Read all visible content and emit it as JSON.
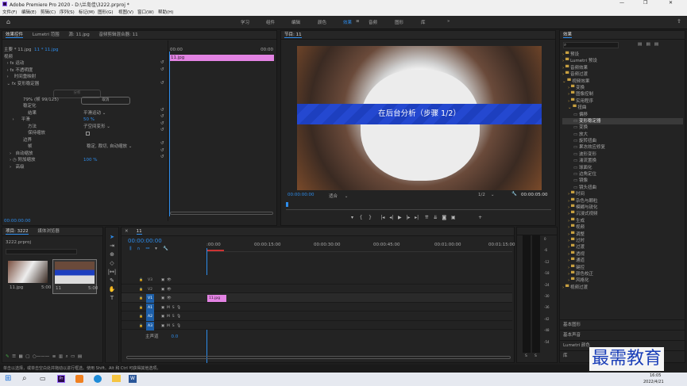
{
  "window": {
    "title": "Adobe Premiere Pro 2020 - D:\\兰岛佳\\3222.prproj *",
    "controls": [
      "—",
      "❐",
      "✕"
    ]
  },
  "menu": [
    "文件(F)",
    "编辑(E)",
    "剪辑(C)",
    "序列(S)",
    "标记(M)",
    "图形(G)",
    "视图(V)",
    "窗口(W)",
    "帮助(H)"
  ],
  "workspaces": [
    "学习",
    "组件",
    "编辑",
    "颜色",
    "效果",
    "音频",
    "图形",
    "库"
  ],
  "workspace_active": "效果",
  "effect_controls": {
    "tabs": [
      "效果控件",
      "Lumetri 范围",
      "源: 11.jpg",
      "音频剪辑混合器: 11"
    ],
    "master": "主要 * 11.jpg",
    "seq": "11 * 11.jpg",
    "tc_start": "00:00",
    "tc_end": "00:00",
    "clip": "11.jpg",
    "section": "视频",
    "rows": [
      "运动",
      "不透明度",
      "时间重映射",
      "变形稳定器"
    ],
    "status_line": "79% (帧 99/125)",
    "analyze_label": "分析",
    "cancel_label": "取消",
    "stab": "稳定化",
    "result_label": "结果",
    "result_val": "平滑运动",
    "smooth_label": "平滑",
    "smooth_val": "50 %",
    "method_label": "方法",
    "method_val": "子空间变形",
    "keep_scale": "保持缩放",
    "borders": "边界",
    "framing_label": "帧",
    "framing_val": "稳定, 裁切, 自动缩放",
    "auto_scale": "自动缩放",
    "extra_scale": "附加缩放",
    "extra_val": "100 %",
    "advanced": "高级",
    "timecode": "00:00:00:00"
  },
  "program": {
    "title": "节目: 11",
    "caption": "在后台分析（步骤 1/2）",
    "tc": "00:00:00:00",
    "fit": "适合",
    "quality": "1/2",
    "dur": "00:00:05:00"
  },
  "effects": {
    "title": "效果",
    "items": [
      {
        "l": "预设",
        "d": 0
      },
      {
        "l": "Lumetri 预设",
        "d": 0
      },
      {
        "l": "音频效果",
        "d": 0
      },
      {
        "l": "音频过渡",
        "d": 0
      },
      {
        "l": "视频效果",
        "d": 0,
        "o": true
      },
      {
        "l": "变换",
        "d": 1
      },
      {
        "l": "图像控制",
        "d": 1
      },
      {
        "l": "实用程序",
        "d": 1
      },
      {
        "l": "扭曲",
        "d": 1,
        "o": true
      },
      {
        "l": "偏移",
        "d": 2
      },
      {
        "l": "变形稳定器",
        "d": 2,
        "sel": true
      },
      {
        "l": "变换",
        "d": 2
      },
      {
        "l": "放大",
        "d": 2
      },
      {
        "l": "旋转扭曲",
        "d": 2
      },
      {
        "l": "果冻效应修复",
        "d": 2
      },
      {
        "l": "波形变形",
        "d": 2
      },
      {
        "l": "湍流置换",
        "d": 2
      },
      {
        "l": "球面化",
        "d": 2
      },
      {
        "l": "边角定位",
        "d": 2
      },
      {
        "l": "镜像",
        "d": 2
      },
      {
        "l": "镜头扭曲",
        "d": 2
      },
      {
        "l": "时间",
        "d": 1
      },
      {
        "l": "杂色与颗粒",
        "d": 1
      },
      {
        "l": "模糊与锐化",
        "d": 1
      },
      {
        "l": "沉浸式视频",
        "d": 1
      },
      {
        "l": "生成",
        "d": 1
      },
      {
        "l": "视频",
        "d": 1
      },
      {
        "l": "调整",
        "d": 1
      },
      {
        "l": "过时",
        "d": 1
      },
      {
        "l": "过渡",
        "d": 1
      },
      {
        "l": "透视",
        "d": 1
      },
      {
        "l": "通道",
        "d": 1
      },
      {
        "l": "键控",
        "d": 1
      },
      {
        "l": "颜色校正",
        "d": 1
      },
      {
        "l": "风格化",
        "d": 1
      },
      {
        "l": "视频过渡",
        "d": 0
      }
    ],
    "bottom": [
      "基本图形",
      "基本声音",
      "Lumetri 颜色",
      "库"
    ]
  },
  "project": {
    "tabs": [
      "项目: 3222",
      "媒体浏览器"
    ],
    "file": "3222.prproj",
    "items": [
      {
        "name": "11.jpg",
        "dur": "5:00"
      },
      {
        "name": "11",
        "dur": "5:00"
      }
    ]
  },
  "timeline": {
    "tab": "11",
    "tc": "00:00:00:00",
    "ruler": [
      ":00:00",
      "00:00:15:00",
      "00:00:30:00",
      "00:00:45:00",
      "00:01:00:00",
      "00:01:15:00"
    ],
    "tracks": [
      "V3",
      "V2",
      "V1",
      "A1",
      "A2",
      "A3"
    ],
    "master": "主声道",
    "master_val": "0.0",
    "clip": "11.jpg"
  },
  "audio_meter": {
    "db": [
      "0",
      "-6",
      "-12",
      "-18",
      "-24",
      "-30",
      "-36",
      "-42",
      "-48",
      "-54"
    ],
    "ch": [
      "S",
      "S"
    ]
  },
  "statusbar": "单击以选择，或单击空白处并拖动以进行框选。使用 Shift、Alt 和 Ctrl 可获得其他选项。",
  "taskbar": {
    "time": "16:05",
    "date": "2022/4/21"
  },
  "watermark": "最需教育"
}
